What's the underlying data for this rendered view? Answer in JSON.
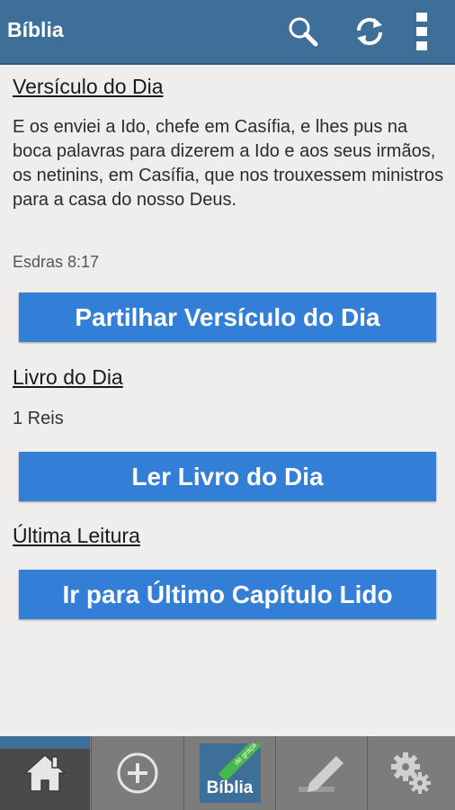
{
  "header": {
    "title": "Bíblia",
    "icons": [
      "search-icon",
      "refresh-icon",
      "overflow-menu-icon"
    ]
  },
  "verse_of_day": {
    "heading": "Versículo do Dia",
    "text": "E os enviei a Ido, chefe em Casífia, e lhes pus na boca palavras para dizerem a Ido e aos seus irmãos, os netinins, em Casífia, que nos trouxessem ministros para a casa do nosso Deus.",
    "reference": "Esdras 8:17",
    "share_button": "Partilhar Versículo do Dia"
  },
  "book_of_day": {
    "heading": "Livro do Dia",
    "book": "1 Reis",
    "read_button": "Ler Livro do Dia"
  },
  "last_reading": {
    "heading": "Última Leitura",
    "go_button": "Ir para Último Capítulo Lido"
  },
  "bottom_nav": {
    "items": [
      "home-icon",
      "add-icon",
      "bible-logo-icon",
      "pen-icon",
      "settings-icon"
    ],
    "logo_text": "Bíblia",
    "logo_ribbon": "de graça"
  },
  "colors": {
    "header": "#3d6f99",
    "button": "#337ed6",
    "background": "#efeeed",
    "bottom_bar": "#7c7c7c"
  }
}
